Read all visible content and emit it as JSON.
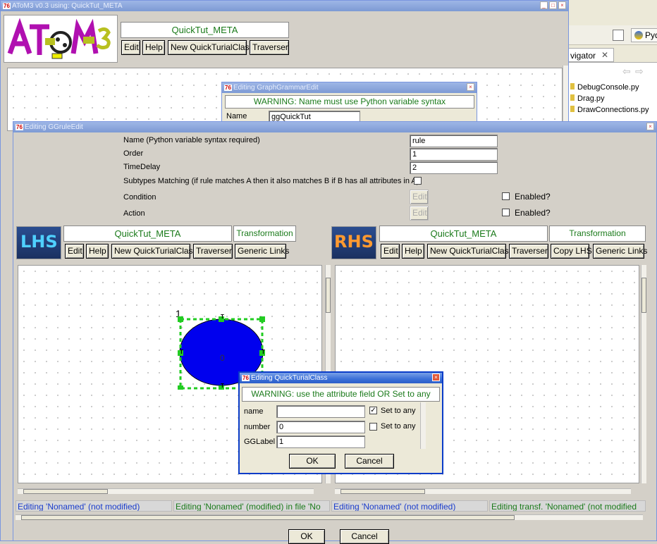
{
  "main_window": {
    "title": "AToM3 v0.3 using: QuickTut_META",
    "banner": "QuickTut_META",
    "buttons": [
      "Edit",
      "Help",
      "New QuickTurialClass",
      "Traverser"
    ]
  },
  "eclipse": {
    "tab_label": "vigator",
    "tab_close": "✕",
    "perspective_label": "Pyde",
    "files": [
      "DebugConsole.py",
      "Drag.py",
      "DrawConnections.py"
    ]
  },
  "gg_edit": {
    "title": "Editing GraphGrammarEdit",
    "warning": "WARNING: Name must use Python variable syntax",
    "name_label": "Name",
    "name_value": "ggQuickTut"
  },
  "rule_edit": {
    "title": "Editing GGruleEdit",
    "fields": [
      {
        "label": "Name (Python variable syntax required)",
        "value": "rule"
      },
      {
        "label": "Order",
        "value": "1"
      },
      {
        "label": "TimeDelay",
        "value": "2"
      }
    ],
    "subtypes_label": "Subtypes Matching (if rule matches A then it also matches B if B has all attributes in A)",
    "condition_label": "Condition",
    "action_label": "Action",
    "edit_label": "Edit",
    "enabled_label": "Enabled?",
    "ok": "OK",
    "cancel": "Cancel"
  },
  "lhs": {
    "logo": "LHS",
    "banner": "QuickTut_META",
    "transformation": "Transformation",
    "buttons": [
      "Edit",
      "Help",
      "New QuickTurialClass",
      "Traverser",
      "Generic Links"
    ],
    "node_label": "1",
    "node_text": "0",
    "handle_glyph": "T",
    "status_left": "Editing 'Nonamed' (not modified)",
    "status_right": "Editing 'Nonamed' (modified) in file 'No"
  },
  "rhs": {
    "logo": "RHS",
    "banner": "QuickTut_META",
    "transformation": "Transformation",
    "buttons": [
      "Edit",
      "Help",
      "New QuickTurialClass",
      "Traverser",
      "Copy LHS",
      "Generic Links"
    ],
    "status_left": "Editing 'Nonamed' (not modified)",
    "status_right": "Editing transf. 'Nonamed' (not modified"
  },
  "class_dialog": {
    "title": "Editing QuickTurialClass",
    "warning": "WARNING: use the attribute field OR Set to any",
    "rows": [
      {
        "label": "name",
        "value": "",
        "set_any": true
      },
      {
        "label": "number",
        "value": "0",
        "set_any": false
      },
      {
        "label": "GGLabel",
        "value": "1"
      }
    ],
    "set_any_label": "Set to any",
    "ok": "OK",
    "cancel": "Cancel"
  },
  "colors": {
    "title_bar": "#2d5fc8",
    "banner_text": "#1a7a1a",
    "status_blue": "#1a3ccc",
    "status_green": "#1a7a1a",
    "node_fill": "#0000ee",
    "handle_green": "#22cc22"
  }
}
